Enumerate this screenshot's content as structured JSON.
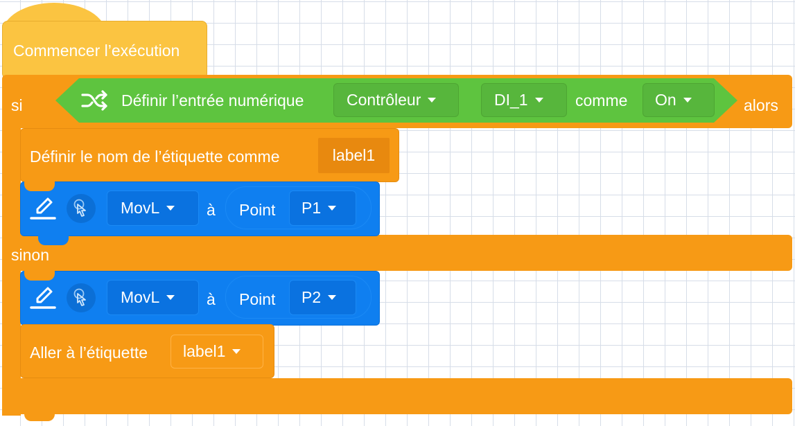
{
  "hat": {
    "label": "Commencer l’exécution"
  },
  "if_block": {
    "if_label": "si",
    "then_label": "alors",
    "else_label": "sinon"
  },
  "condition": {
    "icon": "shuffle-icon",
    "label": "Définir l’entrée numérique",
    "device": "Contrôleur",
    "input": "DI_1",
    "as_label": "comme",
    "state": "On"
  },
  "set_label_block": {
    "label": "Définir le nom de l’étiquette comme",
    "value": "label1"
  },
  "move_block_1": {
    "icons": [
      "edit-pencil-icon",
      "touch-pointer-icon"
    ],
    "mode": "MovL",
    "to_label": "à",
    "point_label": "Point",
    "point": "P1"
  },
  "move_block_2": {
    "icons": [
      "edit-pencil-icon",
      "touch-pointer-icon"
    ],
    "mode": "MovL",
    "to_label": "à",
    "point_label": "Point",
    "point": "P2"
  },
  "goto_block": {
    "label": "Aller à l’étiquette",
    "value": "label1"
  },
  "colors": {
    "hat": "#fbc441",
    "control": "#f79a15",
    "condition": "#5ec43f",
    "motion": "#0f7ff0"
  }
}
